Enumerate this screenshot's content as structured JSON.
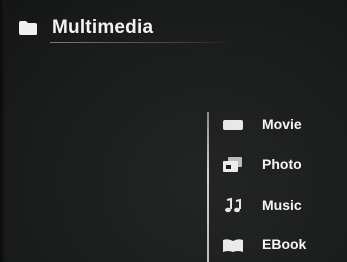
{
  "header": {
    "icon": "folder-icon",
    "title": "Multimedia"
  },
  "menu": {
    "items": [
      {
        "label": "Movie",
        "icon": "movie-icon"
      },
      {
        "label": "Photo",
        "icon": "photo-icon"
      },
      {
        "label": "Music",
        "icon": "music-icon"
      },
      {
        "label": "EBook",
        "icon": "ebook-icon"
      }
    ]
  },
  "colors": {
    "background": "#1b1d1c",
    "text": "#f5f5f5",
    "divider": "#bdbdbd"
  }
}
